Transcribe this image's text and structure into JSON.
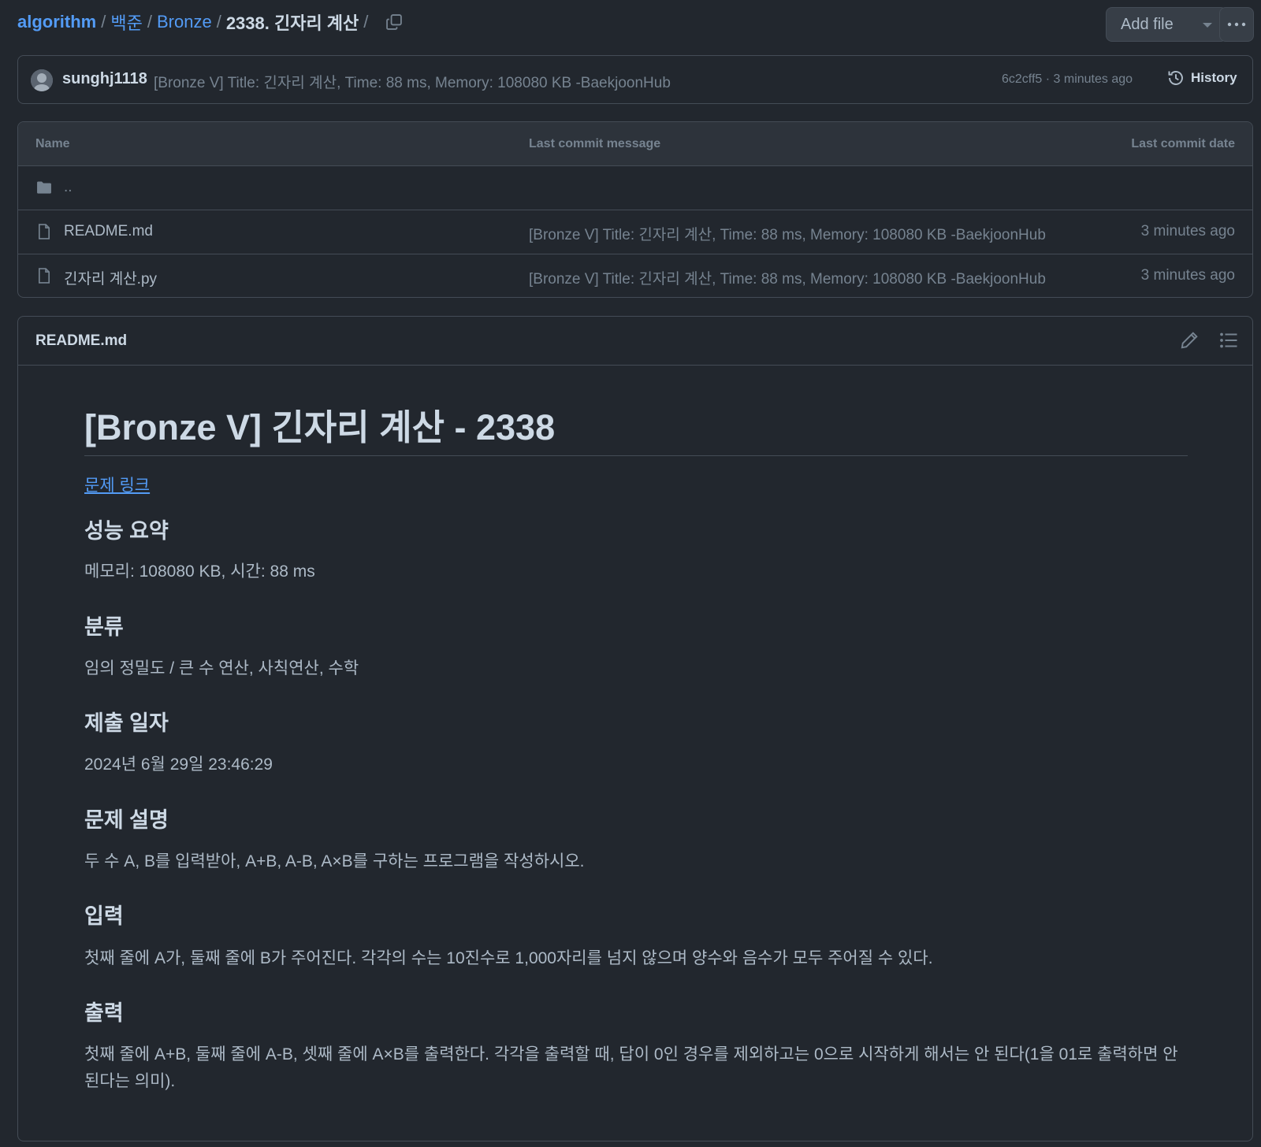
{
  "breadcrumb": {
    "root": "algorithm",
    "level1": "백준",
    "level2": "Bronze",
    "current": "2338. 긴자리 계산",
    "separator": "/"
  },
  "actions": {
    "add_file": "Add file"
  },
  "commit": {
    "user": "sunghj1118",
    "message": "[Bronze V] Title: 긴자리 계산, Time: 88 ms, Memory: 108080 KB -BaekjoonHub",
    "meta": "6c2cff5 · 3 minutes ago",
    "history_label": "History"
  },
  "file_table": {
    "headers": {
      "name": "Name",
      "message": "Last commit message",
      "date": "Last commit date"
    },
    "parent": "..",
    "files": [
      {
        "name": "README.md",
        "message": "[Bronze V] Title: 긴자리 계산, Time: 88 ms, Memory: 108080 KB -BaekjoonHub",
        "date": "3 minutes ago"
      },
      {
        "name": "긴자리 계산.py",
        "message": "[Bronze V] Title: 긴자리 계산, Time: 88 ms, Memory: 108080 KB -BaekjoonHub",
        "date": "3 minutes ago"
      }
    ]
  },
  "readme": {
    "filename": "README.md",
    "title": "[Bronze V] 긴자리 계산 - 2338",
    "problem_link": "문제 링크",
    "sections": [
      {
        "heading": "성능 요약",
        "body": "메모리: 108080 KB, 시간: 88 ms"
      },
      {
        "heading": "분류",
        "body": "임의 정밀도 / 큰 수 연산, 사칙연산, 수학"
      },
      {
        "heading": "제출 일자",
        "body": "2024년 6월 29일 23:46:29"
      },
      {
        "heading": "문제 설명",
        "body": "두 수 A, B를 입력받아, A+B, A-B, A×B를 구하는 프로그램을 작성하시오."
      },
      {
        "heading": "입력",
        "body": "첫째 줄에 A가, 둘째 줄에 B가 주어진다. 각각의 수는 10진수로 1,000자리를 넘지 않으며 양수와 음수가 모두 주어질 수 있다."
      },
      {
        "heading": "출력",
        "body": "첫째 줄에 A+B, 둘째 줄에 A-B, 셋째 줄에 A×B를 출력한다. 각각을 출력할 때, 답이 0인 경우를 제외하고는 0으로 시작하게 해서는 안 된다(1을 01로 출력하면 안 된다는 의미)."
      }
    ]
  },
  "colors": {
    "background": "#22272e",
    "border": "#444c56",
    "link": "#539bf5",
    "text": "#adbac7",
    "muted": "#768390",
    "heading": "#cdd9e5"
  },
  "icons": [
    "copy-icon",
    "caret-down-icon",
    "kebab-icon",
    "avatar",
    "history-icon",
    "folder-icon",
    "file-icon",
    "pencil-icon",
    "list-icon"
  ]
}
